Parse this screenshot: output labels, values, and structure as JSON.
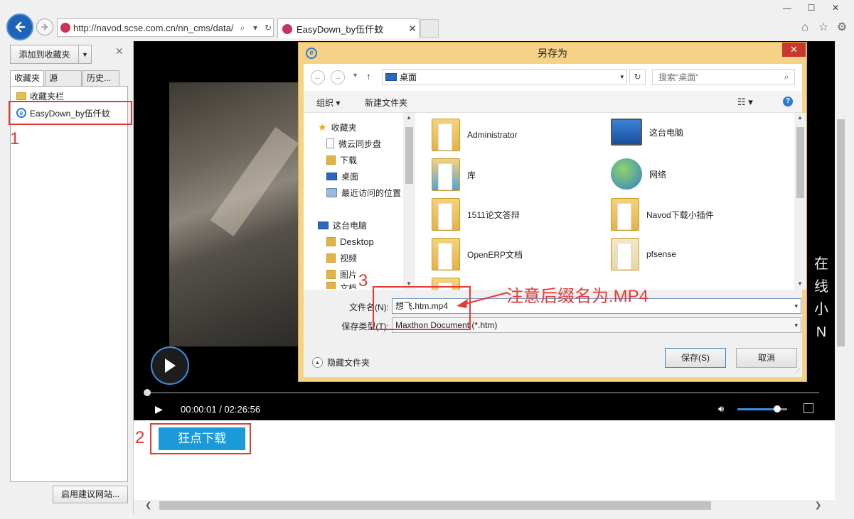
{
  "browser": {
    "address": "http://navod.scse.com.cn/nn_cms/data/",
    "tab_title": "EasyDown_by伍仟蚊",
    "accent": "#1e63b8"
  },
  "favorites": {
    "add_label": "添加到收藏夹",
    "tabs": [
      "收藏夹",
      "源",
      "历史..."
    ],
    "items": [
      "收藏夹栏",
      "EasyDown_by伍仟蚊"
    ],
    "suggest_label": "启用建议网站..."
  },
  "annotations": {
    "num1": "1",
    "num2": "2",
    "num3": "3",
    "note": "注意后缀名为.MP4",
    "color": "#e53935"
  },
  "player": {
    "time": "00:00:01 / 02:26:56",
    "progress_fraction": 0.001,
    "volume_fraction": 0.8,
    "side_text": [
      "在",
      "线",
      "小",
      "N"
    ]
  },
  "download_button": "狂点下载",
  "dialog": {
    "title": "另存为",
    "path": "桌面",
    "search_placeholder": "搜索\"桌面\"",
    "toolbar": {
      "organize": "组织 ▾",
      "new_folder": "新建文件夹"
    },
    "nav": [
      "收藏夹",
      "微云同步盘",
      "下载",
      "桌面",
      "最近访问的位置",
      "这台电脑",
      "Desktop",
      "视频",
      "图片",
      "文档"
    ],
    "files_left": [
      "Administrator",
      "库",
      "1511论文答辩",
      "OpenERP文档"
    ],
    "files_right": [
      "这台电脑",
      "网络",
      "Navod下载小插件",
      "pfsense"
    ],
    "filename_label": "文件名(N):",
    "filename_value": "想飞.htm.mp4",
    "filetype_label": "保存类型(T):",
    "filetype_value": "Maxthon Document (*.htm)",
    "hide_folders": "隐藏文件夹",
    "save": "保存(S)",
    "cancel": "取消"
  }
}
